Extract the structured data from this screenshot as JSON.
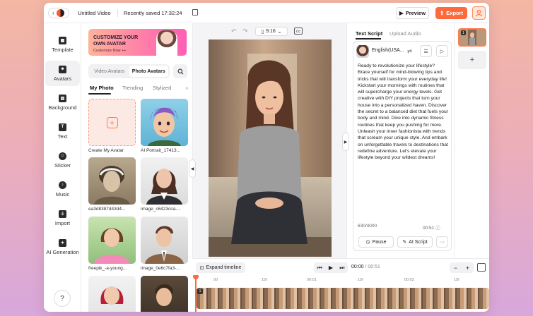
{
  "topbar": {
    "title": "Untitled Video",
    "saved_status": "Recently saved 17:32:24",
    "preview_label": "Preview",
    "export_label": "Export"
  },
  "nav": {
    "items": [
      {
        "label": "Template",
        "icon": "template-icon",
        "active": false
      },
      {
        "label": "Avatars",
        "icon": "avatar-icon",
        "active": true
      },
      {
        "label": "Background",
        "icon": "background-icon",
        "active": false
      },
      {
        "label": "Text",
        "icon": "text-icon",
        "active": false
      },
      {
        "label": "Sticker",
        "icon": "sticker-icon",
        "active": false
      },
      {
        "label": "Music",
        "icon": "music-icon",
        "active": false
      },
      {
        "label": "Import",
        "icon": "import-icon",
        "active": false
      },
      {
        "label": "AI Generation",
        "icon": "ai-generation-icon",
        "active": false
      }
    ],
    "help_label": "?"
  },
  "panel": {
    "banner_title": "CUSTOMIZE YOUR OWN AVATAR",
    "banner_cta": "Customize Now ++",
    "segments": [
      "Video Avatars",
      "Photo Avatars"
    ],
    "filters": [
      "My Photo",
      "Trending",
      "Stylized"
    ],
    "cards": [
      {
        "label": "Create My Avatar"
      },
      {
        "label": "AI Portrait_17413..."
      },
      {
        "label": "ea3d8387d43d4..."
      },
      {
        "label": "image_c6423cca-..."
      },
      {
        "label": "freepik_-a-young..."
      },
      {
        "label": "image_0e6c7fa3-..."
      }
    ]
  },
  "canvas": {
    "ratio": "9:16",
    "cc_label": "CC"
  },
  "script": {
    "tabs": [
      "Text Script",
      "Upload Audio"
    ],
    "voice": "English(USA...",
    "text": "Ready to revolutionize your lifestyle? Brace yourself for mind-blowing tips and tricks that will transform your everyday life! Kickstart your mornings with routines that will supercharge your energy levels. Get creative with DIY projects that turn your house into a personalized haven. Discover the secret to a balanced diet that fuels your body and mind. Dive into dynamic fitness routines that keep you pushing for more. Unleash your inner fashionista with trends that scream your unique style. And embark on unforgettable travels to destinations that redefine adventure. Let's elevate your lifestyle beyond your wildest dreams!",
    "char_count": "630/4000",
    "duration": "00:51",
    "pause_label": "Pause",
    "ai_script_label": "AI Script"
  },
  "scenes": {
    "scene_number": "1",
    "add_label": "+"
  },
  "timeline": {
    "expand_label": "Expand timeline",
    "current_time": "00:00",
    "total_time": "/ 00:51",
    "ticks": [
      "00",
      "15f",
      "00:01",
      "15f",
      "00:02",
      "15f"
    ],
    "track_number": "1"
  },
  "colors": {
    "accent": "#ff6a3d",
    "background_top": "#f3b7a4",
    "background_bottom": "#d8a8dc"
  }
}
